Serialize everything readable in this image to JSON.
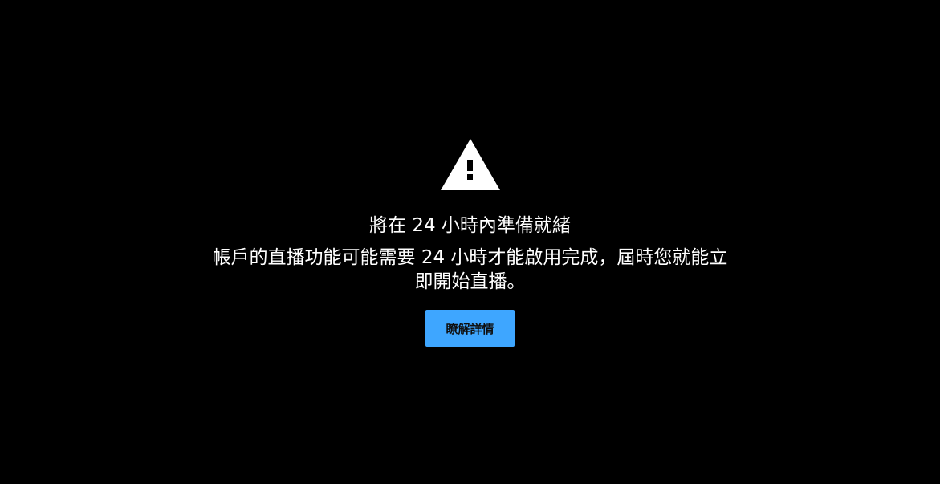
{
  "notice": {
    "icon": "warning-icon",
    "title": "將在 24 小時內準備就緒",
    "message": "帳戶的直播功能可能需要 24 小時才能啟用完成，屆時您就能立即開始直播。",
    "learn_more_label": "瞭解詳情"
  },
  "colors": {
    "background": "#000000",
    "text": "#ffffff",
    "button_bg": "#3ea6ff",
    "button_text": "#0f0f0f"
  }
}
